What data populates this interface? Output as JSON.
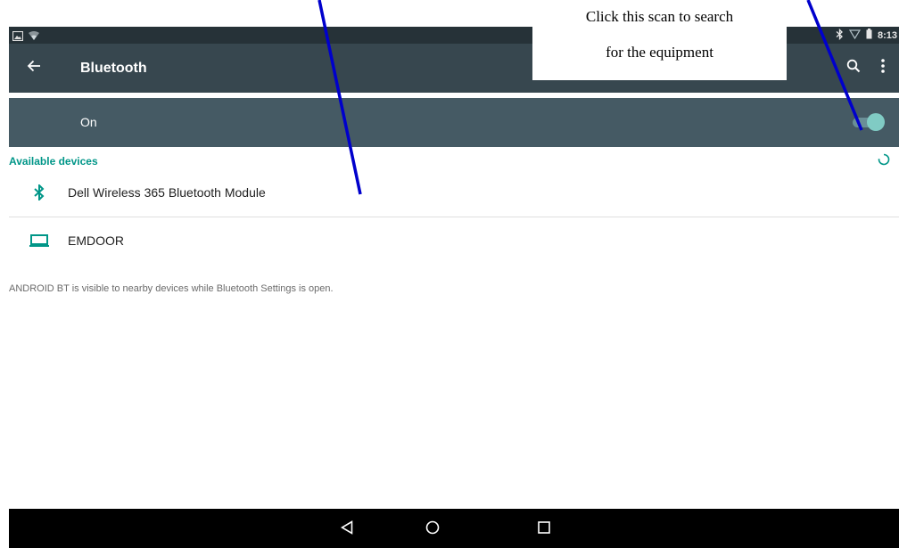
{
  "status_bar": {
    "time": "8:13",
    "icons": [
      "image-notification-icon",
      "wifi-signal-icon",
      "bluetooth-status-icon",
      "signal-icon",
      "battery-icon"
    ]
  },
  "action_bar": {
    "title": "Bluetooth",
    "icons": [
      "back-arrow-icon",
      "search-icon",
      "more-vert-icon"
    ]
  },
  "switch_bar": {
    "label": "On",
    "state": "on"
  },
  "available_devices": {
    "header": "Available devices",
    "items": [
      {
        "label": "Dell Wireless 365 Bluetooth Module",
        "icon": "bluetooth-icon"
      },
      {
        "label": "EMDOOR",
        "icon": "laptop-icon"
      }
    ]
  },
  "footer_note": "ANDROID BT is visible to nearby devices while Bluetooth Settings is open.",
  "annotation": {
    "line1": "Click this scan to search",
    "line2": "for the equipment"
  },
  "nav_bar": {
    "icons": [
      "back-triangle-icon",
      "home-circle-icon",
      "recents-square-icon"
    ]
  },
  "colors": {
    "status_bar": "#263238",
    "action_bar": "#37474f",
    "switch_bar": "#455a64",
    "accent": "#009688",
    "pointer": "#0000cc"
  }
}
